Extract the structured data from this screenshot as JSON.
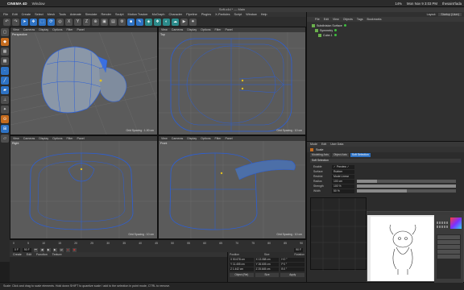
{
  "mac": {
    "app_name": "CINEMA 4D",
    "menu": [
      "Window"
    ],
    "right": [
      "14%",
      "Mon Nov 9  3:03 PM",
      "thesaint'lada"
    ]
  },
  "window_title": "Soft.c4d * — Main",
  "c4d_menu": [
    "File",
    "Edit",
    "Create",
    "Select",
    "Mesh",
    "Tools",
    "Animate",
    "Simulate",
    "Render",
    "Sculpt",
    "Motion Tracker",
    "MoGraph",
    "Character",
    "Pipeline",
    "Plugins",
    "X-Particles",
    "Script",
    "Window",
    "Help"
  ],
  "toolbar_icons": [
    {
      "icon": "undo-icon",
      "c": "g",
      "g": "↶"
    },
    {
      "icon": "redo-icon",
      "c": "g",
      "g": "↷"
    },
    {
      "icon": "select-icon",
      "c": "b",
      "g": "➤"
    },
    {
      "icon": "move-icon",
      "c": "b",
      "g": "✥"
    },
    {
      "icon": "scale-icon",
      "c": "b",
      "g": "⬚"
    },
    {
      "icon": "rotate-icon",
      "c": "b",
      "g": "⟳"
    },
    {
      "icon": "recent-tools-icon",
      "c": "g",
      "g": "◎"
    },
    {
      "icon": "x-axis-icon",
      "c": "g",
      "g": "X"
    },
    {
      "icon": "y-axis-icon",
      "c": "g",
      "g": "Y"
    },
    {
      "icon": "z-axis-icon",
      "c": "g",
      "g": "Z"
    },
    {
      "icon": "coordinate-system-icon",
      "c": "g",
      "g": "⊕"
    },
    {
      "icon": "render-view-icon",
      "c": "g",
      "g": "▣"
    },
    {
      "icon": "render-picture-viewer-icon",
      "c": "g",
      "g": "▤"
    },
    {
      "icon": "render-settings-icon",
      "c": "g",
      "g": "⚙"
    },
    {
      "icon": "cube-icon",
      "c": "b",
      "g": "■"
    },
    {
      "icon": "pen-icon",
      "c": "b",
      "g": "✎"
    },
    {
      "icon": "subdivision-icon",
      "c": "t",
      "g": "◈"
    },
    {
      "icon": "array-icon",
      "c": "t",
      "g": "❖"
    },
    {
      "icon": "deformer-icon",
      "c": "t",
      "g": "◐"
    },
    {
      "icon": "environment-icon",
      "c": "t",
      "g": "☁"
    },
    {
      "icon": "camera-icon",
      "c": "g",
      "g": "▶"
    },
    {
      "icon": "light-icon",
      "c": "g",
      "g": "✷"
    }
  ],
  "left_tools": [
    {
      "icon": "make-editable-icon",
      "c": "g",
      "g": "▢"
    },
    {
      "icon": "model-mode-icon",
      "c": "o",
      "g": "◆"
    },
    {
      "icon": "texture-mode-icon",
      "c": "g",
      "g": "▦"
    },
    {
      "icon": "workplane-icon",
      "c": "g",
      "g": "▩"
    },
    {
      "icon": "points-mode-icon",
      "c": "b",
      "g": "·"
    },
    {
      "icon": "edges-mode-icon",
      "c": "b",
      "g": "╱"
    },
    {
      "icon": "polygons-mode-icon",
      "c": "b",
      "g": "▰"
    },
    {
      "icon": "axis-mode-icon",
      "c": "g",
      "g": "⊥"
    },
    {
      "icon": "tweak-mode-icon",
      "c": "g",
      "g": "✦"
    },
    {
      "icon": "snap-icon",
      "c": "o",
      "g": "⊙"
    },
    {
      "icon": "lock-workplane-icon",
      "c": "b",
      "g": "⊞"
    },
    {
      "icon": "planar-workplane-icon",
      "c": "g",
      "g": "▱"
    }
  ],
  "viewport_menu": [
    "View",
    "Cameras",
    "Display",
    "Options",
    "Filter",
    "Panel"
  ],
  "viewports": {
    "perspective": {
      "name": "Perspective",
      "grid": "Grid Spacing : 1.00 cm"
    },
    "top": {
      "name": "Top",
      "grid": "Grid Spacing : 10 cm"
    },
    "right": {
      "name": "Right",
      "grid": "Grid Spacing : 10 cm"
    },
    "front": {
      "name": "Front",
      "grid": "Grid Spacing : 10 cm"
    }
  },
  "timeline": {
    "ticks": [
      "0",
      "5",
      "10",
      "15",
      "20",
      "25",
      "30",
      "35",
      "40",
      "45",
      "50",
      "55",
      "60",
      "65",
      "70",
      "75",
      "80",
      "85",
      "90"
    ],
    "start": "0 F",
    "end": "90 F",
    "current": "90 F"
  },
  "material_menu": [
    "Create",
    "Edit",
    "Function",
    "Texture"
  ],
  "coordinates": {
    "headers": [
      "Position",
      "Size",
      "Rotation"
    ],
    "rows": [
      [
        "X  50.678 cm",
        "X  13.088 cm",
        "H  0 °"
      ],
      [
        "Y  11.455 cm",
        "Y  26.605 cm",
        "P  0 °"
      ],
      [
        "Z  1.442 cm",
        "Z  25.645 cm",
        "B  0 °"
      ]
    ],
    "mode": "Object (Rel)",
    "size_mode": "Size",
    "apply": "Apply"
  },
  "status_text": "Scale: Click and drag to scale elements. Hold down SHIFT to quantize scale / add to the selection in point mode, CTRL to remove.",
  "object_manager": {
    "layout_label": "Layout:",
    "layout_value": "Startup (User)",
    "menu": [
      "File",
      "Edit",
      "View",
      "Objects",
      "Tags",
      "Bookmarks"
    ],
    "objects": [
      "Subdivision Surface",
      "Symmetry",
      "Cube.1"
    ]
  },
  "attributes": {
    "menu": [
      "Mode",
      "Edit",
      "User Data"
    ],
    "object_title": "Scale",
    "tabs": [
      "Modeling Axis",
      "Object Axis",
      "Soft Selection"
    ],
    "section": "Soft Selection",
    "props": [
      {
        "label": "Enable",
        "value": "✓  Preview ✓",
        "fill": 0
      },
      {
        "label": "Surface",
        "value": "Rubber",
        "fill": 0
      },
      {
        "label": "Restrict",
        "value": "Mode  Linear",
        "fill": 0
      },
      {
        "label": "Radius",
        "value": "100 cm",
        "fill": 0.2
      },
      {
        "label": "Strength",
        "value": "100 %",
        "fill": 1.0
      },
      {
        "label": "Width",
        "value": "50 %",
        "fill": 0.5
      }
    ]
  }
}
